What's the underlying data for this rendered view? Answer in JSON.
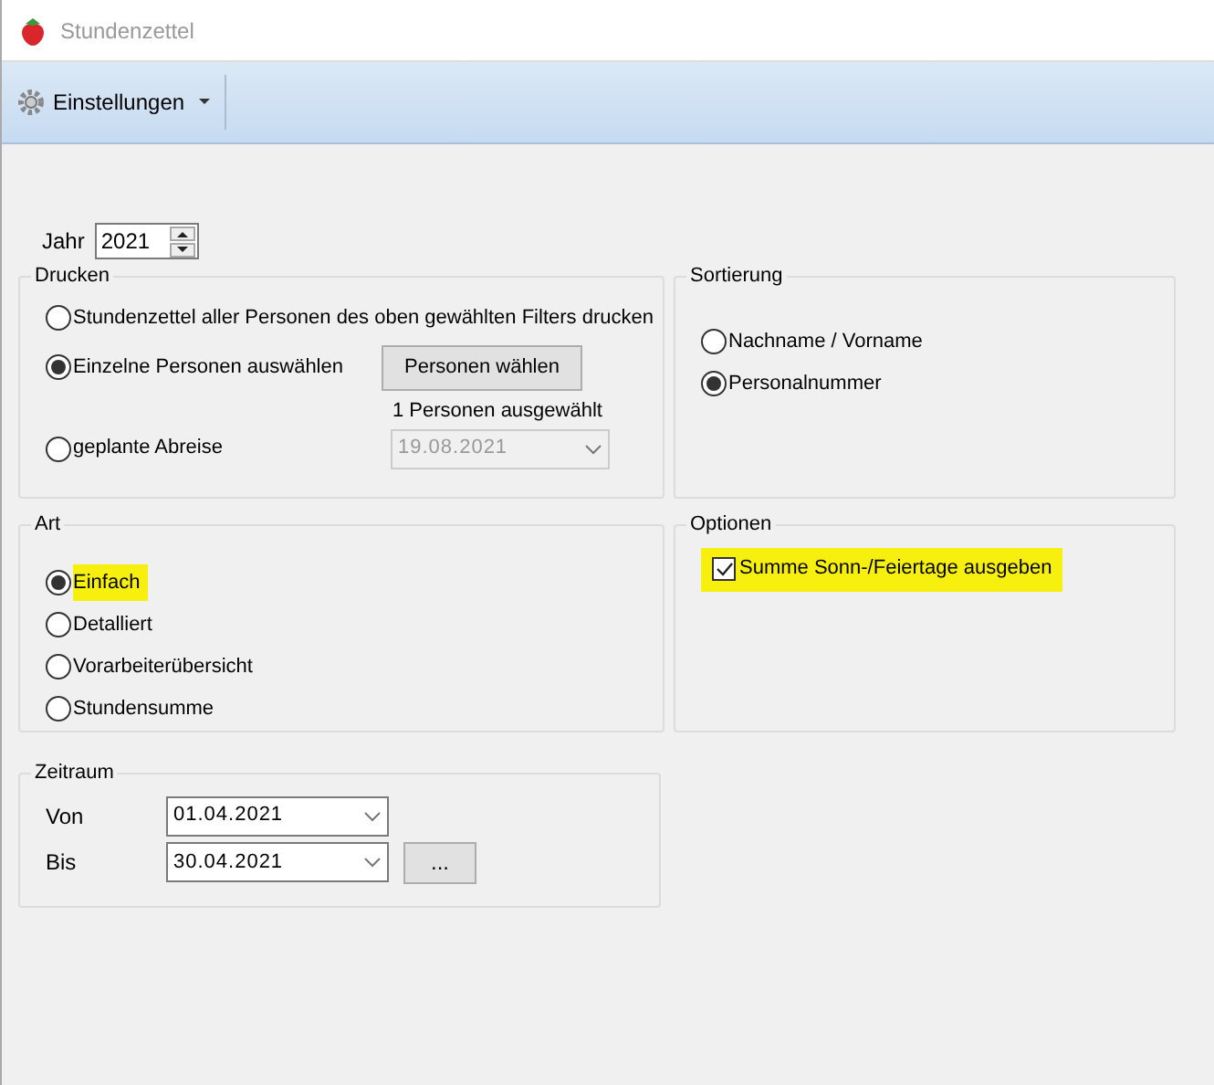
{
  "window": {
    "title": "Stundenzettel"
  },
  "toolbar": {
    "menu": "Einstellungen"
  },
  "year": {
    "label": "Jahr",
    "value": "2021"
  },
  "drucken": {
    "title": "Drucken",
    "options": [
      {
        "label": "Stundenzettel aller Personen des oben gewählten Filters drucken",
        "selected": false
      },
      {
        "label": "Einzelne Personen auswählen",
        "selected": true
      },
      {
        "label": "geplante Abreise",
        "selected": false
      }
    ],
    "button": "Personen wählen",
    "selection_info": "1 Personen ausgewählt",
    "date": {
      "value": "19.08.2021",
      "disabled": true
    }
  },
  "sortierung": {
    "title": "Sortierung",
    "options": [
      {
        "label": "Nachname / Vorname",
        "selected": false
      },
      {
        "label": "Personalnummer",
        "selected": true
      }
    ]
  },
  "art": {
    "title": "Art",
    "options": [
      {
        "label": "Einfach",
        "selected": true,
        "highlighted": true
      },
      {
        "label": "Detalliert",
        "selected": false,
        "highlighted": false
      },
      {
        "label": "Vorarbeiterübersicht",
        "selected": false,
        "highlighted": false
      },
      {
        "label": "Stundensumme",
        "selected": false,
        "highlighted": false
      }
    ]
  },
  "optionen": {
    "title": "Optionen",
    "options": [
      {
        "label": "Summe Sonn-/Feiertage ausgeben",
        "checked": true,
        "highlighted": true
      }
    ]
  },
  "zeitraum": {
    "title": "Zeitraum",
    "von": {
      "label": "Von",
      "value": "01.04.2021"
    },
    "bis": {
      "label": "Bis",
      "value": "30.04.2021"
    },
    "button": "..."
  }
}
